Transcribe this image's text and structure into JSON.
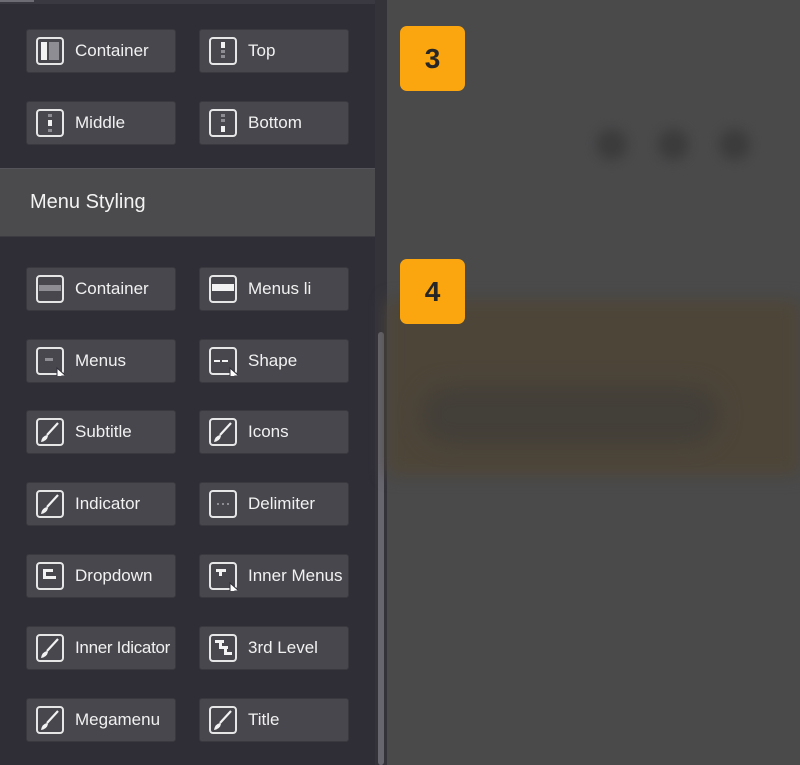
{
  "section_top": {
    "buttons": [
      {
        "label": "Container",
        "icon": "column-layout-icon"
      },
      {
        "label": "Top",
        "icon": "vertical-top-icon"
      },
      {
        "label": "Middle",
        "icon": "vertical-middle-icon"
      },
      {
        "label": "Bottom",
        "icon": "vertical-bottom-icon"
      }
    ]
  },
  "menu_styling": {
    "title": "Menu Styling",
    "buttons": [
      {
        "label": "Container",
        "icon": "row-layout-icon"
      },
      {
        "label": "Menus li",
        "icon": "row-highlight-icon"
      },
      {
        "label": "Menus",
        "icon": "menu-item-cursor-icon"
      },
      {
        "label": "Shape",
        "icon": "shape-cursor-icon"
      },
      {
        "label": "Subtitle",
        "icon": "brush-icon"
      },
      {
        "label": "Icons",
        "icon": "brush-icon"
      },
      {
        "label": "Indicator",
        "icon": "brush-icon"
      },
      {
        "label": "Delimiter",
        "icon": "dots-icon"
      },
      {
        "label": "Dropdown",
        "icon": "dropdown-icon"
      },
      {
        "label": "Inner Menus",
        "icon": "inner-menu-cursor-icon"
      },
      {
        "label": "Inner Idicator",
        "icon": "brush-icon"
      },
      {
        "label": "3rd Level",
        "icon": "third-level-icon"
      },
      {
        "label": "Megamenu",
        "icon": "brush-icon"
      },
      {
        "label": "Title",
        "icon": "brush-icon"
      }
    ]
  },
  "badges": [
    "3",
    "4"
  ],
  "colors": {
    "sidebar_bg": "#2f2e37",
    "button_bg": "#48474d",
    "header_bg": "#4b4a4c",
    "badge": "#fca60f",
    "preview_bg": "#4a4a4b"
  }
}
